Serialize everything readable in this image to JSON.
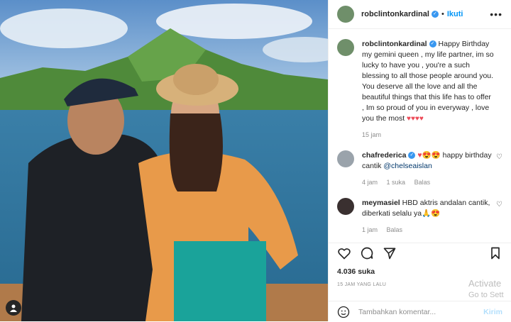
{
  "post": {
    "username": "robclintonkardinal",
    "follow_label": "Ikuti",
    "more_icon": "more-icon"
  },
  "caption": {
    "username": "robclintonkardinal",
    "text": "Happy Birthday my gemini queen , my life partner, im so lucky to have you , you're a such blessing to all those people around you. You deserve all the love and all the beautiful things that this life has to offer , Im so proud of you in everyway , love you the most",
    "hearts": "♥♥♥♥",
    "time": "15 jam"
  },
  "comments": [
    {
      "username": "chafrederica",
      "emojis": "♥😍😍",
      "text": " happy birthday cantik ",
      "mention": "@chelseaislan",
      "time": "4 jam",
      "likes": "1 suka",
      "reply": "Balas"
    },
    {
      "username": "meymasiel",
      "text": "HBD aktris andalan cantik, diberkati selalu ya",
      "emojis": "🙏😍",
      "time": "1 jam",
      "reply": "Balas"
    }
  ],
  "stats": {
    "likes": "4.036 suka",
    "time_ago": "15 JAM YANG LALU"
  },
  "add_comment": {
    "placeholder": "Tambahkan komentar...",
    "post_label": "Kirim"
  },
  "watermark": {
    "line1": "Activate",
    "line2": "Go to Sett"
  },
  "colors": {
    "link": "#0095f6",
    "verified": "#3897f0",
    "heart": "#ed4956",
    "muted": "#8e8e8e"
  }
}
